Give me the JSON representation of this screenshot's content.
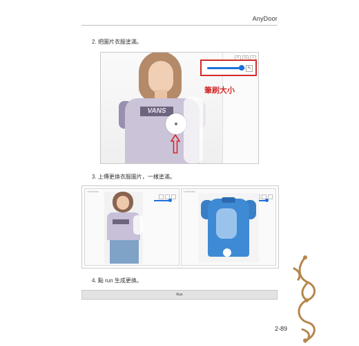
{
  "header": {
    "title": "AnyDoor"
  },
  "steps": [
    {
      "text": "2. 把圖片衣服塗滿。"
    },
    {
      "text": "3. 上傳更換衣服圖片，一樣塗滿。"
    },
    {
      "text": "4. 點 run 生成更換。"
    }
  ],
  "figure1": {
    "callout_label": "筆刷大小",
    "shirt_logo": "VANS",
    "brush_slider_fraction": 0.9
  },
  "figure2": {
    "left_slider_fraction": 0.85,
    "right_slider_fraction": 0.85
  },
  "run_button": {
    "label": "Run"
  },
  "footer": {
    "page_number": "2-89"
  },
  "colors": {
    "accent": "#1e6fd9",
    "callout": "#d42a2a",
    "ornament": "#b5864c"
  }
}
